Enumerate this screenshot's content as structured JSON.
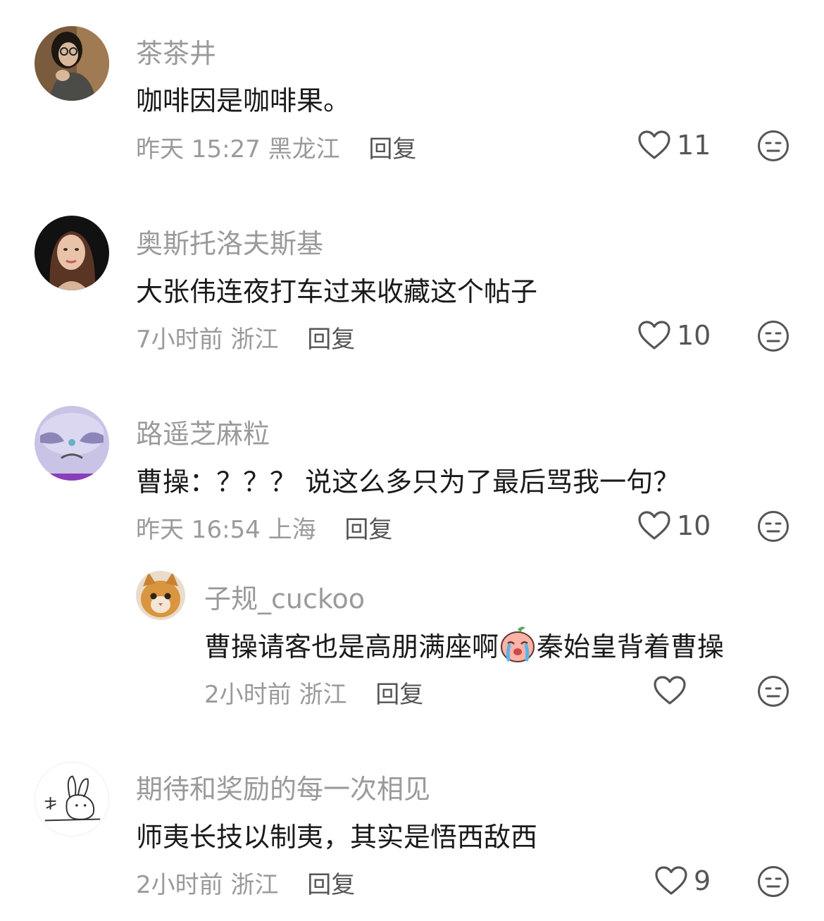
{
  "reply_label": "回复",
  "comments": [
    {
      "username": "茶茶井",
      "text": "咖啡因是咖啡果。",
      "time": "昨天 15:27",
      "location": "黑龙江",
      "likes": "11",
      "avatar_icon": "portrait-woman-glasses"
    },
    {
      "username": "奥斯托洛夫斯基",
      "text": "大张伟连夜打车过来收藏这个帖子",
      "time": "7小时前",
      "location": "浙江",
      "likes": "10",
      "avatar_icon": "portrait-woman"
    },
    {
      "username": "路遥芝麻粒",
      "text": "曹操：？？？ 说这么多只为了最后骂我一句？",
      "time": "昨天 16:54",
      "location": "上海",
      "likes": "10",
      "avatar_icon": "cartoon-cat-face"
    },
    {
      "username": "子规_cuckoo",
      "text_before": "曹操请客也是高朋满座啊",
      "emoji": "crying-peach-emoji",
      "text_after": "秦始皇背着曹操",
      "time": "2小时前",
      "location": "浙江",
      "likes": "",
      "avatar_icon": "orange-cat",
      "is_reply": true
    },
    {
      "username": "期待和奖励的每一次相见",
      "text": "师夷长技以制夷，其实是悟西敌西",
      "time": "2小时前",
      "location": "浙江",
      "likes": "9",
      "avatar_icon": "sketch-rabbit"
    }
  ],
  "colors": {
    "username": "#9a9a9a",
    "text": "#1a1a1a",
    "icon": "#555555"
  }
}
